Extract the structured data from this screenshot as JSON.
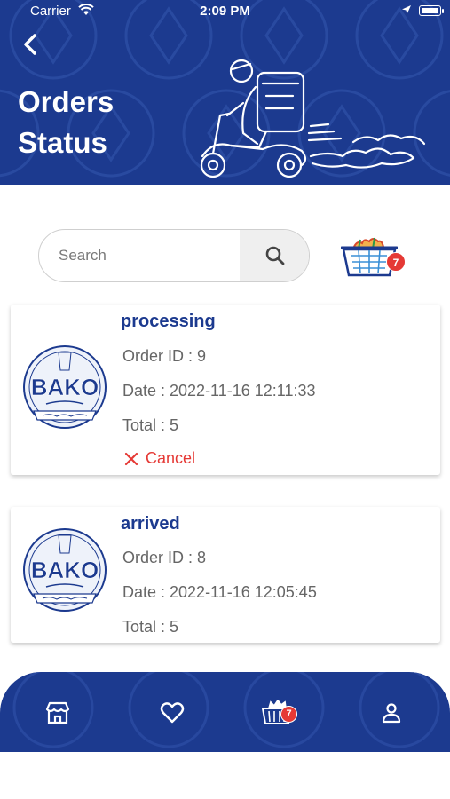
{
  "status_bar": {
    "carrier": "Carrier",
    "time": "2:09 PM"
  },
  "header": {
    "title": "Orders Status"
  },
  "search": {
    "placeholder": "Search"
  },
  "cart": {
    "badge": "7"
  },
  "orders": [
    {
      "status": "processing",
      "order_id": "Order ID : 9",
      "date": "Date : 2022-11-16 12:11:33",
      "total": "Total : 5",
      "cancel_label": "Cancel"
    },
    {
      "status": "arrived",
      "order_id": "Order ID : 8",
      "date": "Date : 2022-11-16 12:05:45",
      "total": "Total : 5"
    }
  ],
  "store_logo": {
    "text": "BAKO"
  },
  "bottom_nav": {
    "cart_badge": "7",
    "items": [
      "store-icon",
      "heart-icon",
      "basket-icon",
      "user-icon"
    ]
  },
  "colors": {
    "brand_blue": "#1c3a8f",
    "accent_red": "#e53935"
  }
}
